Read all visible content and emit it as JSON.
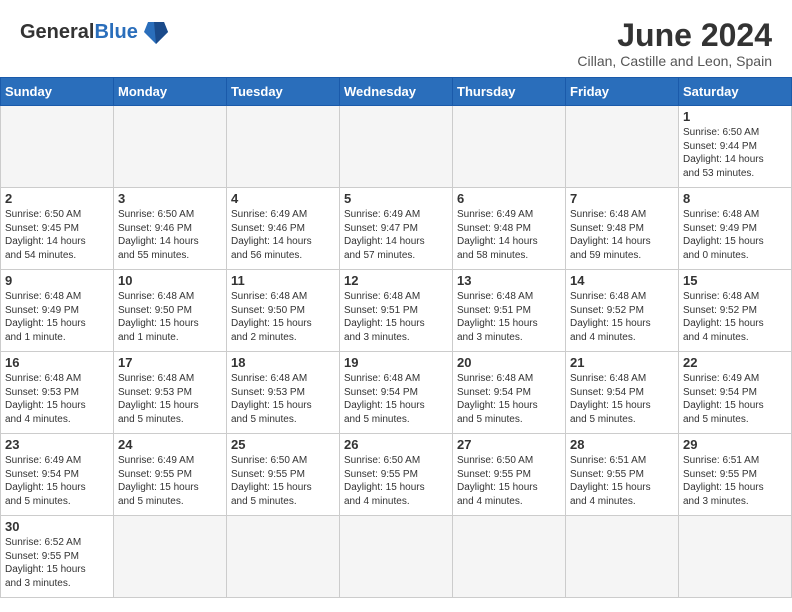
{
  "header": {
    "logo_text_normal": "General",
    "logo_text_bold": "Blue",
    "month_title": "June 2024",
    "subtitle": "Cillan, Castille and Leon, Spain"
  },
  "days_of_week": [
    "Sunday",
    "Monday",
    "Tuesday",
    "Wednesday",
    "Thursday",
    "Friday",
    "Saturday"
  ],
  "weeks": [
    [
      {
        "day": "",
        "empty": true
      },
      {
        "day": "",
        "empty": true
      },
      {
        "day": "",
        "empty": true
      },
      {
        "day": "",
        "empty": true
      },
      {
        "day": "",
        "empty": true
      },
      {
        "day": "",
        "empty": true
      },
      {
        "day": "1",
        "info": "Sunrise: 6:50 AM\nSunset: 9:44 PM\nDaylight: 14 hours\nand 53 minutes."
      }
    ],
    [
      {
        "day": "2",
        "info": "Sunrise: 6:50 AM\nSunset: 9:45 PM\nDaylight: 14 hours\nand 54 minutes."
      },
      {
        "day": "3",
        "info": "Sunrise: 6:50 AM\nSunset: 9:46 PM\nDaylight: 14 hours\nand 55 minutes."
      },
      {
        "day": "4",
        "info": "Sunrise: 6:49 AM\nSunset: 9:46 PM\nDaylight: 14 hours\nand 56 minutes."
      },
      {
        "day": "5",
        "info": "Sunrise: 6:49 AM\nSunset: 9:47 PM\nDaylight: 14 hours\nand 57 minutes."
      },
      {
        "day": "6",
        "info": "Sunrise: 6:49 AM\nSunset: 9:48 PM\nDaylight: 14 hours\nand 58 minutes."
      },
      {
        "day": "7",
        "info": "Sunrise: 6:48 AM\nSunset: 9:48 PM\nDaylight: 14 hours\nand 59 minutes."
      },
      {
        "day": "8",
        "info": "Sunrise: 6:48 AM\nSunset: 9:49 PM\nDaylight: 15 hours\nand 0 minutes."
      }
    ],
    [
      {
        "day": "9",
        "info": "Sunrise: 6:48 AM\nSunset: 9:49 PM\nDaylight: 15 hours\nand 1 minute."
      },
      {
        "day": "10",
        "info": "Sunrise: 6:48 AM\nSunset: 9:50 PM\nDaylight: 15 hours\nand 1 minute."
      },
      {
        "day": "11",
        "info": "Sunrise: 6:48 AM\nSunset: 9:50 PM\nDaylight: 15 hours\nand 2 minutes."
      },
      {
        "day": "12",
        "info": "Sunrise: 6:48 AM\nSunset: 9:51 PM\nDaylight: 15 hours\nand 3 minutes."
      },
      {
        "day": "13",
        "info": "Sunrise: 6:48 AM\nSunset: 9:51 PM\nDaylight: 15 hours\nand 3 minutes."
      },
      {
        "day": "14",
        "info": "Sunrise: 6:48 AM\nSunset: 9:52 PM\nDaylight: 15 hours\nand 4 minutes."
      },
      {
        "day": "15",
        "info": "Sunrise: 6:48 AM\nSunset: 9:52 PM\nDaylight: 15 hours\nand 4 minutes."
      }
    ],
    [
      {
        "day": "16",
        "info": "Sunrise: 6:48 AM\nSunset: 9:53 PM\nDaylight: 15 hours\nand 4 minutes."
      },
      {
        "day": "17",
        "info": "Sunrise: 6:48 AM\nSunset: 9:53 PM\nDaylight: 15 hours\nand 5 minutes."
      },
      {
        "day": "18",
        "info": "Sunrise: 6:48 AM\nSunset: 9:53 PM\nDaylight: 15 hours\nand 5 minutes."
      },
      {
        "day": "19",
        "info": "Sunrise: 6:48 AM\nSunset: 9:54 PM\nDaylight: 15 hours\nand 5 minutes."
      },
      {
        "day": "20",
        "info": "Sunrise: 6:48 AM\nSunset: 9:54 PM\nDaylight: 15 hours\nand 5 minutes."
      },
      {
        "day": "21",
        "info": "Sunrise: 6:48 AM\nSunset: 9:54 PM\nDaylight: 15 hours\nand 5 minutes."
      },
      {
        "day": "22",
        "info": "Sunrise: 6:49 AM\nSunset: 9:54 PM\nDaylight: 15 hours\nand 5 minutes."
      }
    ],
    [
      {
        "day": "23",
        "info": "Sunrise: 6:49 AM\nSunset: 9:54 PM\nDaylight: 15 hours\nand 5 minutes."
      },
      {
        "day": "24",
        "info": "Sunrise: 6:49 AM\nSunset: 9:55 PM\nDaylight: 15 hours\nand 5 minutes."
      },
      {
        "day": "25",
        "info": "Sunrise: 6:50 AM\nSunset: 9:55 PM\nDaylight: 15 hours\nand 5 minutes."
      },
      {
        "day": "26",
        "info": "Sunrise: 6:50 AM\nSunset: 9:55 PM\nDaylight: 15 hours\nand 4 minutes."
      },
      {
        "day": "27",
        "info": "Sunrise: 6:50 AM\nSunset: 9:55 PM\nDaylight: 15 hours\nand 4 minutes."
      },
      {
        "day": "28",
        "info": "Sunrise: 6:51 AM\nSunset: 9:55 PM\nDaylight: 15 hours\nand 4 minutes."
      },
      {
        "day": "29",
        "info": "Sunrise: 6:51 AM\nSunset: 9:55 PM\nDaylight: 15 hours\nand 3 minutes."
      }
    ],
    [
      {
        "day": "30",
        "info": "Sunrise: 6:52 AM\nSunset: 9:55 PM\nDaylight: 15 hours\nand 3 minutes.",
        "last_row": true
      },
      {
        "day": "",
        "empty": true,
        "last_row": true
      },
      {
        "day": "",
        "empty": true,
        "last_row": true
      },
      {
        "day": "",
        "empty": true,
        "last_row": true
      },
      {
        "day": "",
        "empty": true,
        "last_row": true
      },
      {
        "day": "",
        "empty": true,
        "last_row": true
      },
      {
        "day": "",
        "empty": true,
        "last_row": true
      }
    ]
  ]
}
